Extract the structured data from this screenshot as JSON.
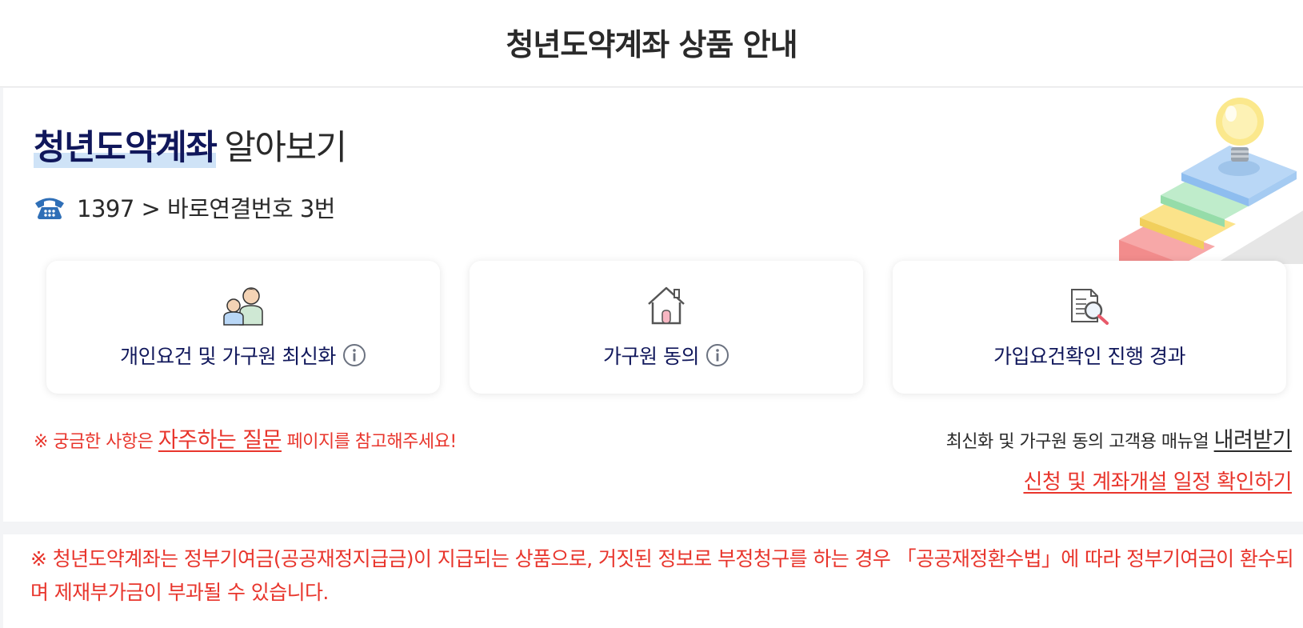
{
  "header": {
    "title": "청년도약계좌 상품 안내"
  },
  "intro": {
    "title_strong": "청년도약계좌",
    "title_rest": "알아보기",
    "phone_icon": "telephone-icon",
    "phone_text": "1397 > 바로연결번호 3번",
    "illustration": "stairs-lightbulb-illustration"
  },
  "cards": [
    {
      "label": "개인요건 및 가구원 최신화",
      "icon": "family-icon",
      "has_info": true
    },
    {
      "label": "가구원 동의",
      "icon": "house-icon",
      "has_info": true
    },
    {
      "label": "가입요건확인 진행 경과",
      "icon": "document-search-icon",
      "has_info": false
    }
  ],
  "notice": {
    "prefix": "※ 궁금한 사항은 ",
    "faq_link": "자주하는 질문",
    "suffix": " 페이지를 참고해주세요!"
  },
  "manual": {
    "text": "최신화 및 가구원 동의 고객용 매뉴얼 ",
    "download_link": "내려받기"
  },
  "schedule_link": "신청 및 계좌개설 일정 확인하기",
  "warning": "※ 청년도약계좌는 정부기여금(공공재정지급금)이 지급되는 상품으로, 거짓된 정보로 부정청구를 하는 경우 「공공재정환수법」에 따라 정부기여금이 환수되며 제재부가금이 부과될 수 있습니다.",
  "colors": {
    "navy": "#10175b",
    "red": "#e8352c",
    "highlight": "#cfe3f7",
    "phone_blue": "#2f6fb7"
  }
}
